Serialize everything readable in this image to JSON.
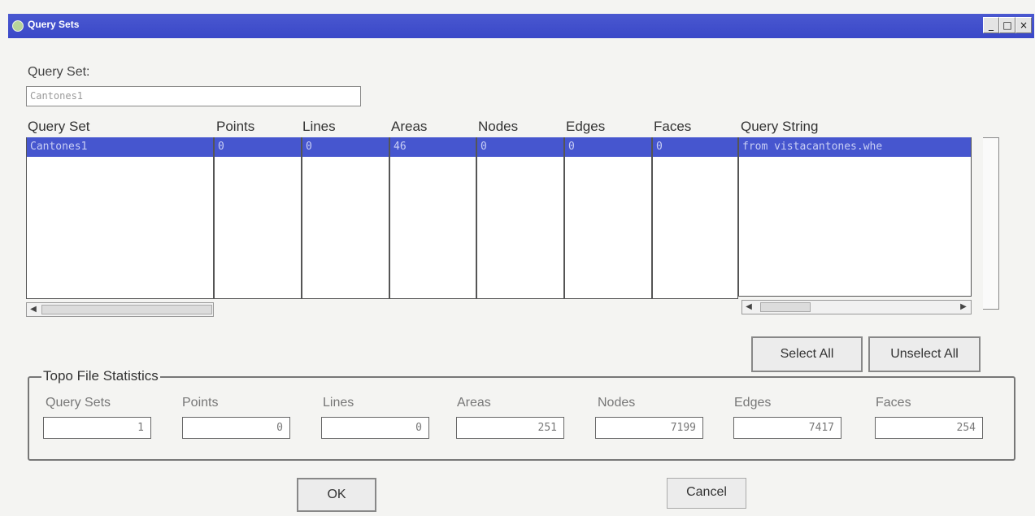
{
  "window": {
    "title": "Query Sets",
    "controls": [
      "_",
      "□",
      "×"
    ]
  },
  "query_set": {
    "label": "Query Set:",
    "value": "Cantones1"
  },
  "table": {
    "headers": [
      "Query Set",
      "Points",
      "Lines",
      "Areas",
      "Nodes",
      "Edges",
      "Faces",
      "Query String"
    ],
    "rows": [
      [
        "Cantones1",
        "0",
        "0",
        "46",
        "0",
        "0",
        "0",
        "from vistacantones.whe"
      ]
    ]
  },
  "scroll": {
    "left": "◀",
    "right": "▶"
  },
  "buttons": {
    "select_all": "Select All",
    "unselect_all": "Unselect All",
    "ok": "OK",
    "cancel": "Cancel"
  },
  "stats": {
    "title": "Topo File Statistics",
    "labels": [
      "Query Sets",
      "Points",
      "Lines",
      "Areas",
      "Nodes",
      "Edges",
      "Faces"
    ],
    "values": [
      "1",
      "0",
      "0",
      "251",
      "7199",
      "7417",
      "254"
    ]
  }
}
